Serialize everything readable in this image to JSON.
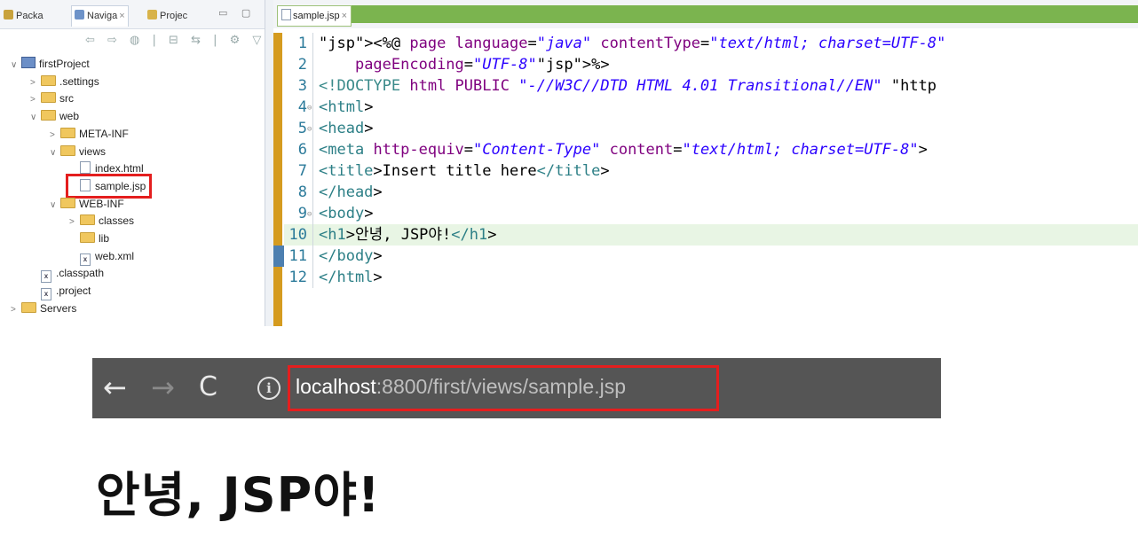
{
  "left_panel": {
    "tabs": [
      {
        "label": "Packa",
        "icon": "package-icon"
      },
      {
        "label": "Naviga",
        "icon": "navigator-icon",
        "close": "×"
      },
      {
        "label": "Projec",
        "icon": "project-icon"
      }
    ],
    "view_controls": "▭ ▢",
    "toolbar_icons": "⇦ ⇨ ◍ | ⊟ ⇆ | ⚙ ▽",
    "tree": [
      {
        "label": "firstProject",
        "type": "project",
        "twisty": "∨"
      },
      {
        "label": ".settings",
        "type": "folder",
        "twisty": ">"
      },
      {
        "label": "src",
        "type": "folder",
        "twisty": ">"
      },
      {
        "label": "web",
        "type": "folder",
        "twisty": "∨"
      },
      {
        "label": "META-INF",
        "type": "folder",
        "twisty": ">"
      },
      {
        "label": "views",
        "type": "folder",
        "twisty": "∨"
      },
      {
        "label": "index.html",
        "type": "file",
        "twisty": ""
      },
      {
        "label": "sample.jsp",
        "type": "file",
        "twisty": "",
        "highlighted": true
      },
      {
        "label": "WEB-INF",
        "type": "folder",
        "twisty": "∨"
      },
      {
        "label": "classes",
        "type": "folder",
        "twisty": ">"
      },
      {
        "label": "lib",
        "type": "folder",
        "twisty": ""
      },
      {
        "label": "web.xml",
        "type": "xml",
        "twisty": ""
      },
      {
        "label": ".classpath",
        "type": "xml",
        "twisty": ""
      },
      {
        "label": ".project",
        "type": "xml",
        "twisty": ""
      },
      {
        "label": "Servers",
        "type": "folder",
        "twisty": ">"
      }
    ]
  },
  "editor": {
    "tab_label": "sample.jsp",
    "tab_close": "×",
    "lines": [
      {
        "num": "1",
        "text": "<%@ page language=\"java\" contentType=\"text/html; charset=UTF-8\""
      },
      {
        "num": "2",
        "text": "    pageEncoding=\"UTF-8\"%>"
      },
      {
        "num": "3",
        "text": "<!DOCTYPE html PUBLIC \"-//W3C//DTD HTML 4.01 Transitional//EN\" \"http"
      },
      {
        "num": "4",
        "text": "<html>",
        "fold": "⊖"
      },
      {
        "num": "5",
        "text": "<head>",
        "fold": "⊖"
      },
      {
        "num": "6",
        "text": "<meta http-equiv=\"Content-Type\" content=\"text/html; charset=UTF-8\">"
      },
      {
        "num": "7",
        "text": "<title>Insert title here</title>"
      },
      {
        "num": "8",
        "text": "</head>"
      },
      {
        "num": "9",
        "text": "<body>",
        "fold": "⊖"
      },
      {
        "num": "10",
        "text": "<h1>안녕, JSP야!</h1>",
        "current": true
      },
      {
        "num": "11",
        "text": "</body>"
      },
      {
        "num": "12",
        "text": "</html>"
      }
    ]
  },
  "browser": {
    "back": "←",
    "forward": "→",
    "reload": "C",
    "info": "i",
    "url_host": "localhost",
    "url_rest": ":8800/first/views/sample.jsp"
  },
  "page": {
    "heading": "안녕, JSP야!"
  },
  "colors": {
    "highlight_red": "#e41e1e",
    "editor_green_bar": "#7bb44f",
    "gutter_orange": "#d59b1f",
    "browser_bar": "#555555"
  }
}
